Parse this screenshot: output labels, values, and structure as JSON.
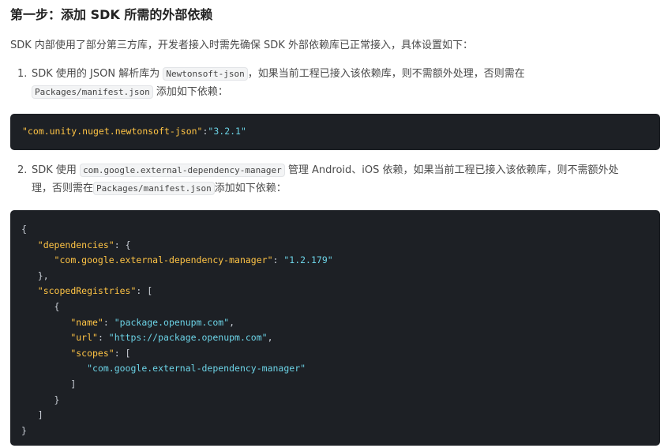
{
  "heading": "第一步：添加 SDK 所需的外部依赖",
  "intro": "SDK 内部使用了部分第三方库，开发者接入时需先确保 SDK 外部依赖库已正常接入，具体设置如下：",
  "step1": {
    "number": "1.",
    "text_a": "SDK 使用的 JSON 解析库为",
    "code_a": "Newtonsoft-json",
    "text_b": "，如果当前工程已接入该依赖库，则不需额外处理，否则需在",
    "code_b": "Packages/manifest.json",
    "text_c": "添加如下依赖："
  },
  "code1": {
    "key": "\"com.unity.nuget.newtonsoft-json\"",
    "colon": ":",
    "value": "\"3.2.1\""
  },
  "step2": {
    "number": "2.",
    "text_a": "SDK 使用",
    "code_a": "com.google.external-dependency-manager",
    "text_b": "管理 Android、iOS 依赖，如果当前工程已接入该依赖库，则不需额外处",
    "text_c": "理，否则需在",
    "code_b": "Packages/manifest.json",
    "text_d": "添加如下依赖："
  },
  "code2": {
    "open_brace": "{",
    "dependencies_key": "\"dependencies\"",
    "colon_brace": ": {",
    "edm_key": "\"com.google.external-dependency-manager\"",
    "colon": ": ",
    "edm_version": "\"1.2.179\"",
    "close_brace_comma": "},",
    "scoped_key": "\"scopedRegistries\"",
    "colon_bracket": ": [",
    "obj_open": "{",
    "name_key": "\"name\"",
    "name_value": "\"package.openupm.com\"",
    "comma": ",",
    "url_key": "\"url\"",
    "url_value": "\"https://package.openupm.com\"",
    "scopes_key": "\"scopes\"",
    "scope_value": "\"com.google.external-dependency-manager\"",
    "scopes_close": "]",
    "obj_close": "}",
    "array_close": "]",
    "close_brace": "}"
  },
  "colors": {
    "code_background": "#1d2025",
    "json_key": "#ffc445",
    "json_string": "#6cd3e6"
  }
}
